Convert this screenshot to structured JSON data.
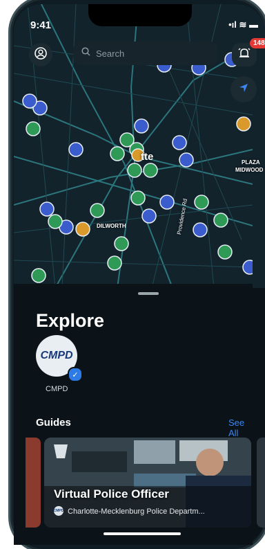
{
  "status_bar": {
    "time": "9:41",
    "right": "•ıl ≋ ▬"
  },
  "search": {
    "placeholder": "Search"
  },
  "notifications": {
    "count": "148"
  },
  "map": {
    "labels": {
      "city": "tte",
      "plaza": "PLAZA",
      "midwood": "MIDWOOD",
      "dilworth": "DILWORTH",
      "road": "Providence Rd"
    }
  },
  "explore": {
    "title": "Explore",
    "source": {
      "logo_text": "CMPD",
      "label": "CMPD"
    }
  },
  "guides": {
    "title": "Guides",
    "see_all": "See All",
    "card": {
      "title": "Virtual Police Officer",
      "subtitle": "Charlotte-Mecklenburg Police Departm...",
      "logo_text": "CMPD"
    }
  },
  "colors": {
    "accent": "#3b86f0",
    "pin_blue": "#3a5ccc",
    "pin_green": "#2e9a56",
    "pin_orange": "#d99a2b",
    "badge": "#e53935"
  }
}
